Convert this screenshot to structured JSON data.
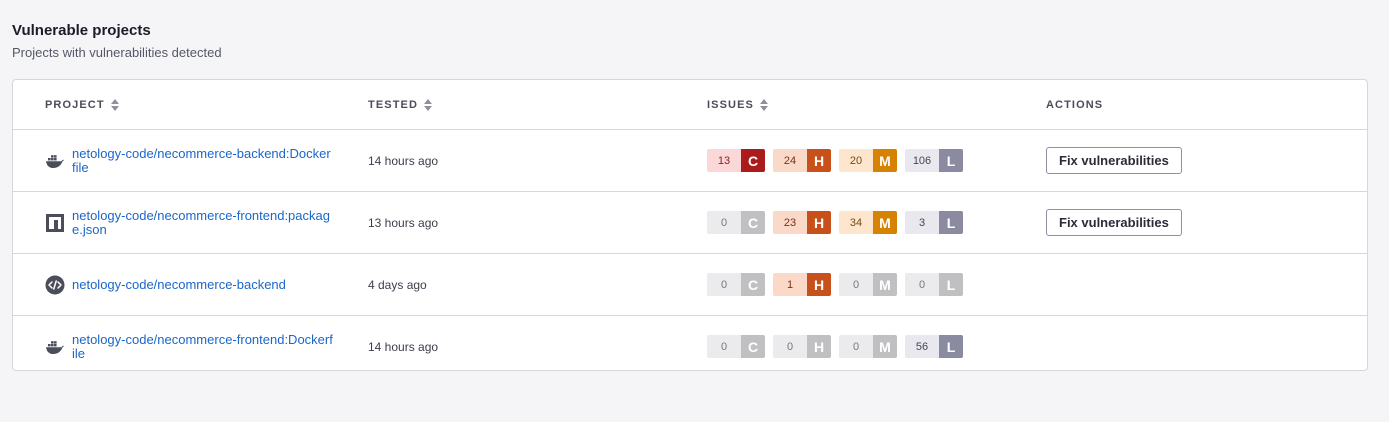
{
  "header": {
    "title": "Vulnerable projects",
    "subtitle": "Projects with vulnerabilities detected"
  },
  "table": {
    "columns": {
      "project": "PROJECT",
      "tested": "TESTED",
      "issues": "ISSUES",
      "actions": "ACTIONS"
    },
    "rows": [
      {
        "icon": "docker-icon",
        "name": "netology-code/necommerce-backend:Dockerfile",
        "tested": "14 hours ago",
        "issues": {
          "c": "13",
          "h": "24",
          "m": "20",
          "l": "106"
        },
        "action": "Fix vulnerabilities"
      },
      {
        "icon": "npm-icon",
        "name": "netology-code/necommerce-frontend:package.json",
        "tested": "13 hours ago",
        "issues": {
          "c": "0",
          "h": "23",
          "m": "34",
          "l": "3"
        },
        "action": "Fix vulnerabilities"
      },
      {
        "icon": "code-icon",
        "name": "netology-code/necommerce-backend",
        "tested": "4 days ago",
        "issues": {
          "c": "0",
          "h": "1",
          "m": "0",
          "l": "0"
        },
        "action": ""
      },
      {
        "icon": "docker-icon",
        "name": "netology-code/necommerce-frontend:Dockerfile",
        "tested": "14 hours ago",
        "issues": {
          "c": "0",
          "h": "0",
          "m": "0",
          "l": "56"
        },
        "action": ""
      }
    ],
    "severity_letters": {
      "c": "C",
      "h": "H",
      "m": "M",
      "l": "L"
    }
  },
  "colors": {
    "critical": "#aa1b1b",
    "high": "#c8501a",
    "medium": "#d68303",
    "low": "#8a8aa0",
    "link": "#1b66c9"
  }
}
